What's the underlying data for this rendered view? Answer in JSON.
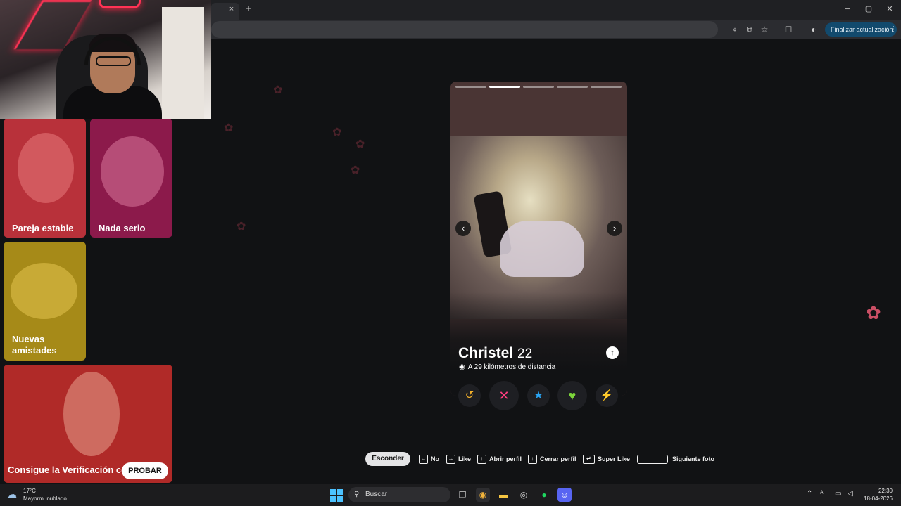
{
  "browser": {
    "update_label": "Finalizar actualización",
    "tab_close": "×",
    "new_tab": "+",
    "minimize": "─",
    "restore": "▢",
    "close": "✕"
  },
  "explore_cards": [
    {
      "label": "Pareja estable",
      "color": "#b8313a"
    },
    {
      "label": "Nada serio",
      "color": "#8c1a4b"
    },
    {
      "label": "Nuevas amistades",
      "color": "#a68a18"
    },
    {
      "label": "Consigue la Verificación co",
      "color": "#b02a28"
    }
  ],
  "verification_button": "PROBAR",
  "profile": {
    "name": "Christel",
    "age": "22",
    "distance": "A 29 kilómetros de distancia",
    "photo_count": 5,
    "active_photo": 2
  },
  "actions": [
    {
      "name": "rewind",
      "glyph": "↺",
      "color": "#f6b22a"
    },
    {
      "name": "nope",
      "glyph": "✕",
      "color": "#ff3d7f"
    },
    {
      "name": "super-like",
      "glyph": "★",
      "color": "#2aa6f5"
    },
    {
      "name": "like",
      "glyph": "♥",
      "color": "#7bd43a"
    },
    {
      "name": "boost",
      "glyph": "⚡",
      "color": "#c43cf2"
    }
  ],
  "shortcuts": {
    "hide": "Esconder",
    "no": "No",
    "like": "Like",
    "open_profile": "Abrir perfil",
    "close_profile": "Cerrar perfil",
    "super_like": "Super Like",
    "next_photo": "Siguiente foto"
  },
  "taskbar": {
    "temperature": "17°C",
    "weather": "Mayorm. nublado",
    "search": "Buscar",
    "time": "22:30",
    "date": "18-04-2026"
  }
}
